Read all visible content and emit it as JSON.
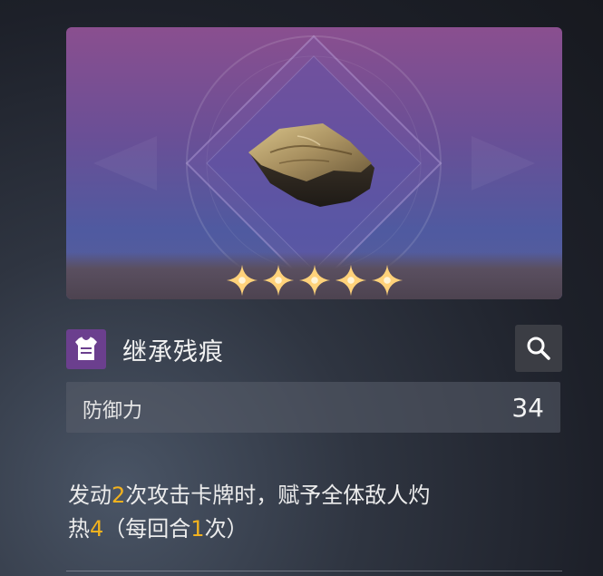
{
  "item": {
    "name": "继承残痕",
    "rarity": 5,
    "type_icon": "armor-vest-icon"
  },
  "stat": {
    "label": "防御力",
    "value": "34"
  },
  "description": {
    "line1": [
      "发动",
      "2",
      "次攻击卡牌时，赋予全体敌人灼"
    ],
    "line2": [
      "热",
      "4",
      "（每回合",
      "1",
      "次）"
    ]
  },
  "actions": {
    "search_icon": "magnifier-icon"
  },
  "colors": {
    "highlight": "#f2b21e",
    "type_icon_bg": "#6b3f8e",
    "star": "#ffd27a"
  }
}
